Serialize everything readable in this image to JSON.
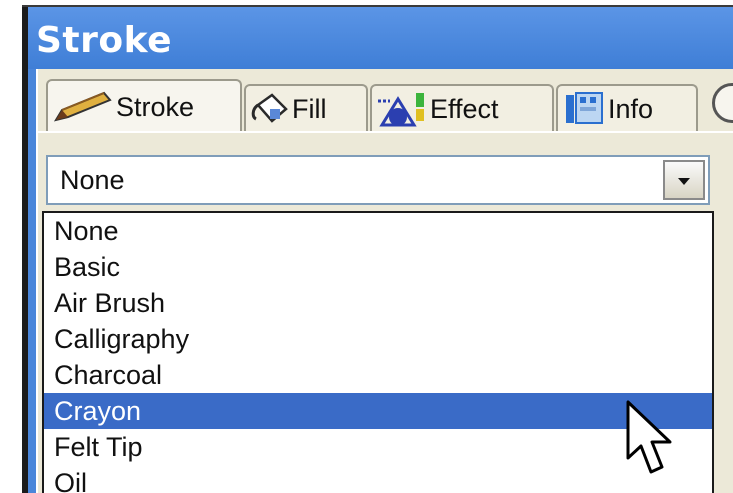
{
  "window": {
    "title": "Stroke"
  },
  "tabs": [
    {
      "label": "Stroke",
      "icon": "pencil-icon",
      "active": true
    },
    {
      "label": "Fill",
      "icon": "paint-bucket-icon",
      "active": false
    },
    {
      "label": "Effect",
      "icon": "effect-icon",
      "active": false
    },
    {
      "label": "Info",
      "icon": "info-icon",
      "active": false
    }
  ],
  "combo": {
    "value": "None"
  },
  "list": {
    "items": [
      "None",
      "Basic",
      "Air Brush",
      "Calligraphy",
      "Charcoal",
      "Crayon",
      "Felt Tip",
      "Oil"
    ],
    "selected": "Crayon"
  },
  "colors": {
    "title_bar": "#4a86da",
    "selection": "#3a6bc7",
    "panel": "#ece9d8"
  }
}
